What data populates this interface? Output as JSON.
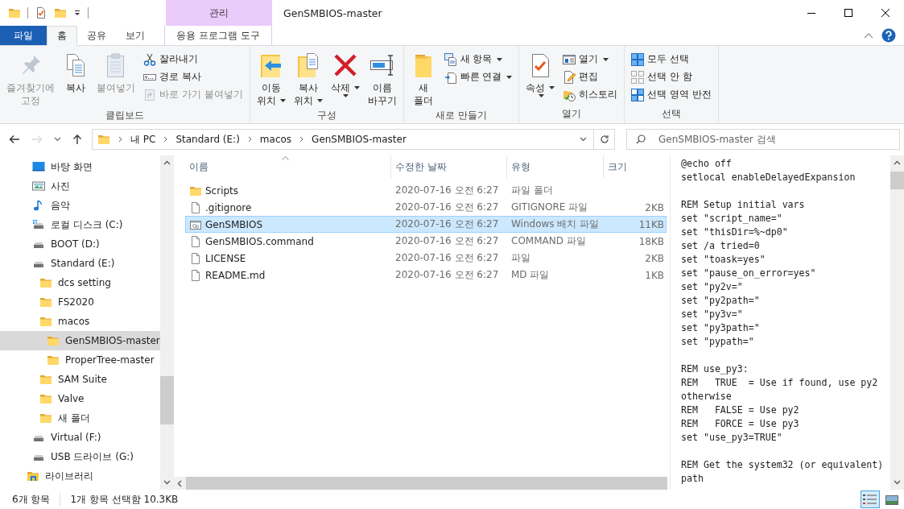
{
  "title_bar": {
    "context_header": "관리",
    "title": "GenSMBIOS-master"
  },
  "tabs": [
    {
      "label": "파일",
      "kind": "file",
      "selected": false
    },
    {
      "label": "홈",
      "kind": "normal",
      "selected": true
    },
    {
      "label": "공유",
      "kind": "normal",
      "selected": false
    },
    {
      "label": "보기",
      "kind": "normal",
      "selected": false
    },
    {
      "label": "응용 프로그램 도구",
      "kind": "context",
      "selected": false
    }
  ],
  "ribbon": {
    "groups": [
      {
        "label": "클립보드",
        "items": [
          {
            "kind": "large",
            "lines": [
              "즐겨찾기에",
              "고정"
            ],
            "disabled": true,
            "dropdown": false
          },
          {
            "kind": "large",
            "lines": [
              "복사"
            ],
            "disabled": false,
            "dropdown": false
          },
          {
            "kind": "large",
            "lines": [
              "붙여넣기"
            ],
            "disabled": true,
            "dropdown": false
          },
          {
            "kind": "small",
            "lines": [
              "잘라내기"
            ],
            "disabled": false,
            "dropdown": false
          },
          {
            "kind": "small",
            "lines": [
              "경로 복사"
            ],
            "disabled": false,
            "dropdown": false
          },
          {
            "kind": "small",
            "lines": [
              "바로 가기 붙여넣기"
            ],
            "disabled": true,
            "dropdown": false
          }
        ]
      },
      {
        "label": "구성",
        "items": [
          {
            "kind": "large",
            "lines": [
              "이동",
              "위치"
            ],
            "disabled": false,
            "dropdown": true
          },
          {
            "kind": "large",
            "lines": [
              "복사",
              "위치"
            ],
            "disabled": false,
            "dropdown": true
          },
          {
            "kind": "large",
            "lines": [
              "삭제"
            ],
            "disabled": false,
            "dropdown": true
          },
          {
            "kind": "large",
            "lines": [
              "이름",
              "바꾸기"
            ],
            "disabled": false,
            "dropdown": false
          }
        ]
      },
      {
        "label": "새로 만들기",
        "items": [
          {
            "kind": "large",
            "lines": [
              "새",
              "폴더"
            ],
            "disabled": false,
            "dropdown": false
          },
          {
            "kind": "small",
            "lines": [
              "새 항목"
            ],
            "disabled": false,
            "dropdown": true
          },
          {
            "kind": "small",
            "lines": [
              "빠른 연결"
            ],
            "disabled": false,
            "dropdown": true
          }
        ]
      },
      {
        "label": "열기",
        "items": [
          {
            "kind": "large",
            "lines": [
              "속성"
            ],
            "disabled": false,
            "dropdown": true
          },
          {
            "kind": "small",
            "lines": [
              "열기"
            ],
            "disabled": false,
            "dropdown": true
          },
          {
            "kind": "small",
            "lines": [
              "편집"
            ],
            "disabled": false,
            "dropdown": false
          },
          {
            "kind": "small",
            "lines": [
              "히스토리"
            ],
            "disabled": false,
            "dropdown": false
          }
        ]
      },
      {
        "label": "선택",
        "items": [
          {
            "kind": "small",
            "lines": [
              "모두 선택"
            ],
            "disabled": false,
            "dropdown": false
          },
          {
            "kind": "small",
            "lines": [
              "선택 안 함"
            ],
            "disabled": false,
            "dropdown": false
          },
          {
            "kind": "small",
            "lines": [
              "선택 영역 반전"
            ],
            "disabled": false,
            "dropdown": false
          }
        ]
      }
    ]
  },
  "navigation": {
    "back": {
      "disabled": false
    },
    "forward": {
      "disabled": true
    }
  },
  "address_bar": {
    "breadcrumbs": [
      "내 PC",
      "Standard (E:)",
      "macos",
      "GenSMBIOS-master"
    ]
  },
  "search": {
    "placeholder": "GenSMBIOS-master 검색"
  },
  "nav_pane": {
    "items": [
      {
        "label": "바탕 화면",
        "kind": "desktop",
        "selected": false
      },
      {
        "label": "사진",
        "kind": "pictures",
        "selected": false
      },
      {
        "label": "음악",
        "kind": "music",
        "selected": false
      },
      {
        "label": "로컬 디스크 (C:)",
        "kind": "system-drive",
        "selected": false
      },
      {
        "label": "BOOT (D:)",
        "kind": "drive",
        "selected": false
      },
      {
        "label": "Standard (E:)",
        "kind": "drive",
        "selected": false,
        "children": [
          {
            "label": "dcs setting",
            "kind": "folder",
            "selected": false
          },
          {
            "label": "FS2020",
            "kind": "folder",
            "selected": false
          },
          {
            "label": "macos",
            "kind": "folder",
            "selected": false,
            "children": [
              {
                "label": "GenSMBIOS-master",
                "kind": "folder",
                "selected": true
              },
              {
                "label": "ProperTree-master",
                "kind": "folder",
                "selected": false
              }
            ]
          },
          {
            "label": "SAM Suite",
            "kind": "folder",
            "selected": false
          },
          {
            "label": "Valve",
            "kind": "folder",
            "selected": false
          },
          {
            "label": "새 폴더",
            "kind": "folder",
            "selected": false
          }
        ]
      },
      {
        "label": "Virtual (F:)",
        "kind": "drive",
        "selected": false
      },
      {
        "label": "USB 드라이브 (G:)",
        "kind": "drive",
        "selected": false
      },
      {
        "label": "라이브러리",
        "kind": "library",
        "selected": false
      }
    ]
  },
  "file_list": {
    "columns": [
      {
        "label": "이름",
        "sorted": true
      },
      {
        "label": "수정한 날짜",
        "sorted": false
      },
      {
        "label": "유형",
        "sorted": false
      },
      {
        "label": "크기",
        "sorted": false
      }
    ],
    "rows": [
      {
        "kind": "folder",
        "name": "Scripts",
        "date": "2020-07-16 오전 6:27",
        "type": "파일 폴더",
        "selected": false
      },
      {
        "kind": "file",
        "name": ".gitignore",
        "date": "2020-07-16 오전 6:27",
        "type": "GITIGNORE 파일",
        "size": "2KB",
        "selected": false
      },
      {
        "kind": "batch",
        "name": "GenSMBIOS",
        "date": "2020-07-16 오전 6:27",
        "type": "Windows 배치 파일",
        "size": "11KB",
        "selected": true
      },
      {
        "kind": "file",
        "name": "GenSMBIOS.command",
        "date": "2020-07-16 오전 6:27",
        "type": "COMMAND 파일",
        "size": "18KB",
        "selected": false
      },
      {
        "kind": "file",
        "name": "LICENSE",
        "date": "2020-07-16 오전 6:27",
        "type": "파일",
        "size": "2KB",
        "selected": false
      },
      {
        "kind": "file",
        "name": "README.md",
        "date": "2020-07-16 오전 6:27",
        "type": "MD 파일",
        "size": "1KB",
        "selected": false
      }
    ]
  },
  "preview": {
    "blocks": [
      [
        "@echo off",
        "setlocal enableDelayedExpansion"
      ],
      [
        "REM Setup initial vars",
        "set \"script_name=\"",
        "set \"thisDir=%~dp0\"",
        "set /a tried=0",
        "set \"toask=yes\"",
        "set \"pause_on_error=yes\"",
        "set \"py2v=\"",
        "set \"py2path=\"",
        "set \"py3v=\"",
        "set \"py3path=\"",
        "set \"pypath=\""
      ],
      [
        "REM use_py3:",
        "REM   TRUE  = Use if found, use py2",
        "otherwise",
        "REM   FALSE = Use py2",
        "REM   FORCE = Use py3",
        "set \"use_py3=TRUE\""
      ],
      [
        "REM Get the system32 (or equivalent)",
        "path"
      ]
    ]
  },
  "status_bar": {
    "item_count": "6개 항목",
    "selection": "1개 항목 선택함 10.3KB",
    "views": [
      {
        "kind": "details",
        "selected": true
      },
      {
        "kind": "large-icons",
        "selected": false
      }
    ]
  }
}
